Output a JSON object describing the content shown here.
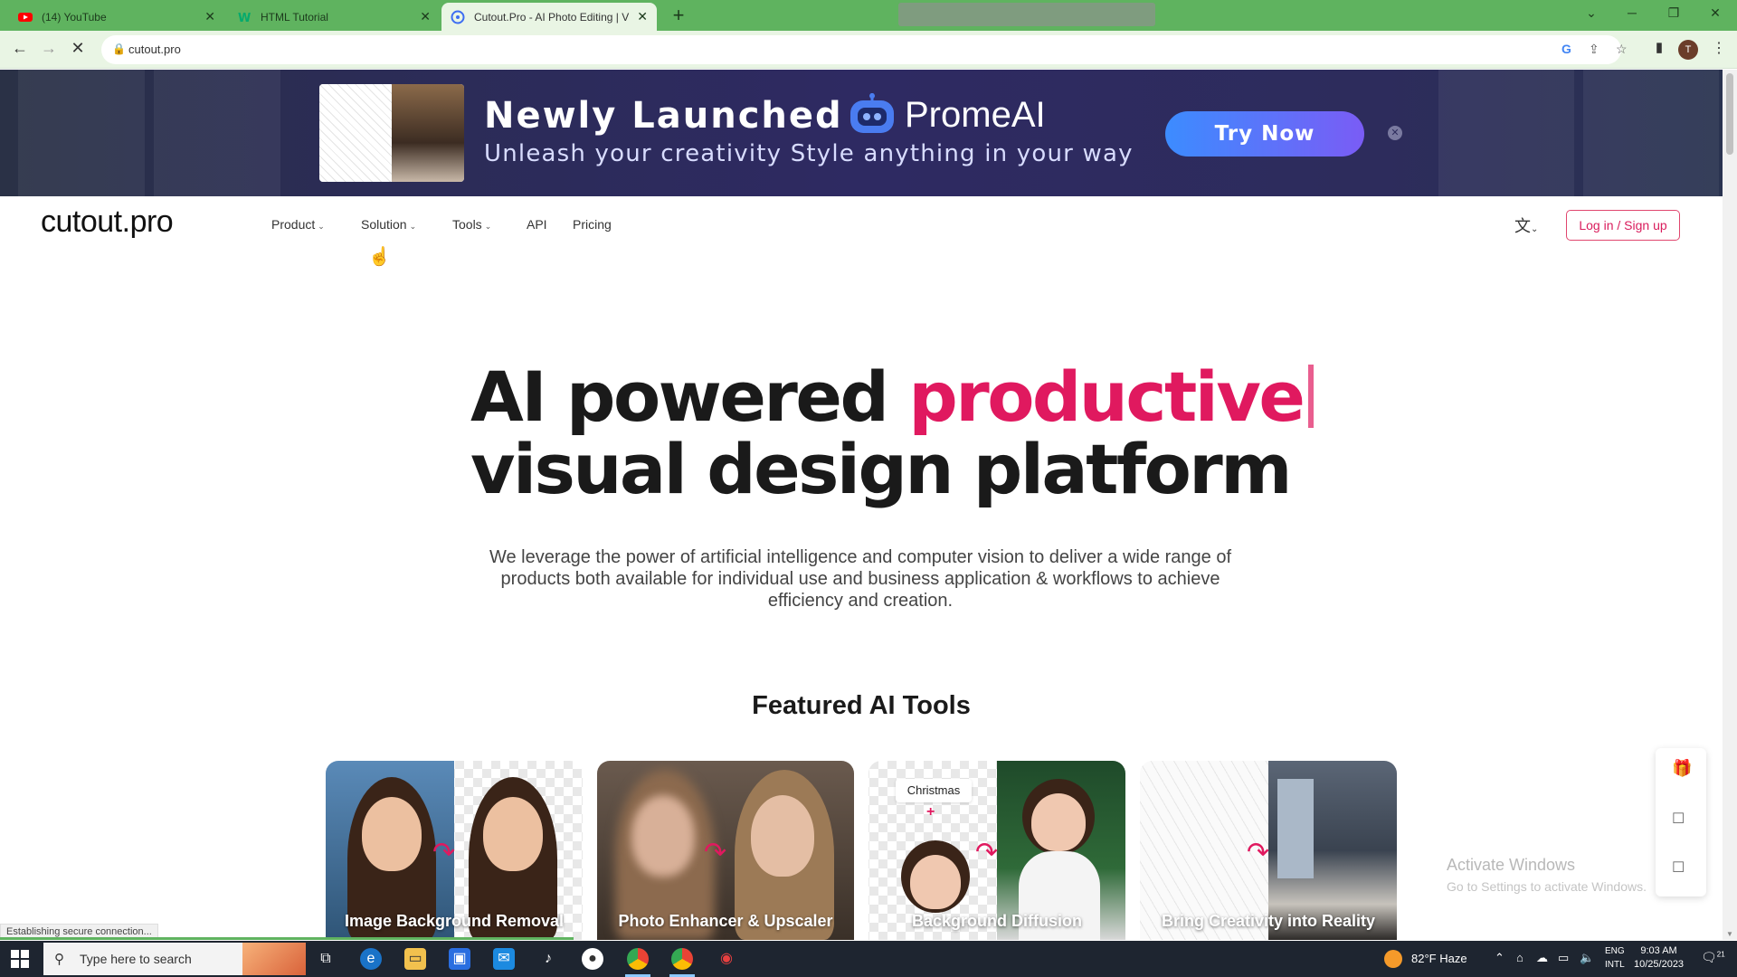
{
  "browser": {
    "tabs": [
      {
        "title": "(14) YouTube",
        "icon": "youtube-icon",
        "color": "#ff0000"
      },
      {
        "title": "HTML Tutorial",
        "icon": "w3schools-icon",
        "color": "#04aa6d"
      },
      {
        "title": "Cutout.Pro - AI Photo Editing | V",
        "icon": "cutout-favicon",
        "color": "#3d6df2",
        "active": true
      }
    ],
    "url": "cutout.pro",
    "profile_initial": "T"
  },
  "banner": {
    "title": "Newly Launched",
    "brand": "PromeAI",
    "subtitle": "Unleash your creativity Style anything in your way",
    "cta": "Try Now"
  },
  "site": {
    "logo": "cutout.pro",
    "nav": [
      {
        "label": "Product",
        "dropdown": true
      },
      {
        "label": "Solution",
        "dropdown": true
      },
      {
        "label": "Tools",
        "dropdown": true
      },
      {
        "label": "API",
        "dropdown": false
      },
      {
        "label": "Pricing",
        "dropdown": false
      }
    ],
    "login": "Log in / Sign up"
  },
  "hero": {
    "line1_plain": "AI powered ",
    "line1_accent": "productive",
    "line2": "visual design platform",
    "description": "We leverage the power of artificial intelligence and computer vision to deliver a wide range of products both available for individual use and business application & workflows to achieve efficiency and creation."
  },
  "featured": {
    "title": "Featured AI Tools",
    "cards": [
      {
        "label": "Image Background Removal"
      },
      {
        "label": "Photo Enhancer & Upscaler"
      },
      {
        "label": "Background Diffusion",
        "tag": "Christmas",
        "plus": "+"
      },
      {
        "label": "Bring Creativity into Reality"
      }
    ]
  },
  "watermark": {
    "line1": "Activate Windows",
    "line2": "Go to Settings to activate Windows."
  },
  "status": {
    "text": "Establishing secure connection...",
    "progress": 0.33
  },
  "taskbar": {
    "search_placeholder": "Type here to search",
    "weather": "82°F  Haze",
    "lang_line1": "ENG",
    "lang_line2": "INTL",
    "time": "9:03 AM",
    "date": "10/25/2023",
    "notif_count": "21"
  },
  "colors": {
    "accent": "#e0195f",
    "browser_frame": "#5fb35f",
    "banner_bg": "#2d2c5c",
    "cta_start": "#3c8cff",
    "cta_end": "#7a5cf5"
  }
}
